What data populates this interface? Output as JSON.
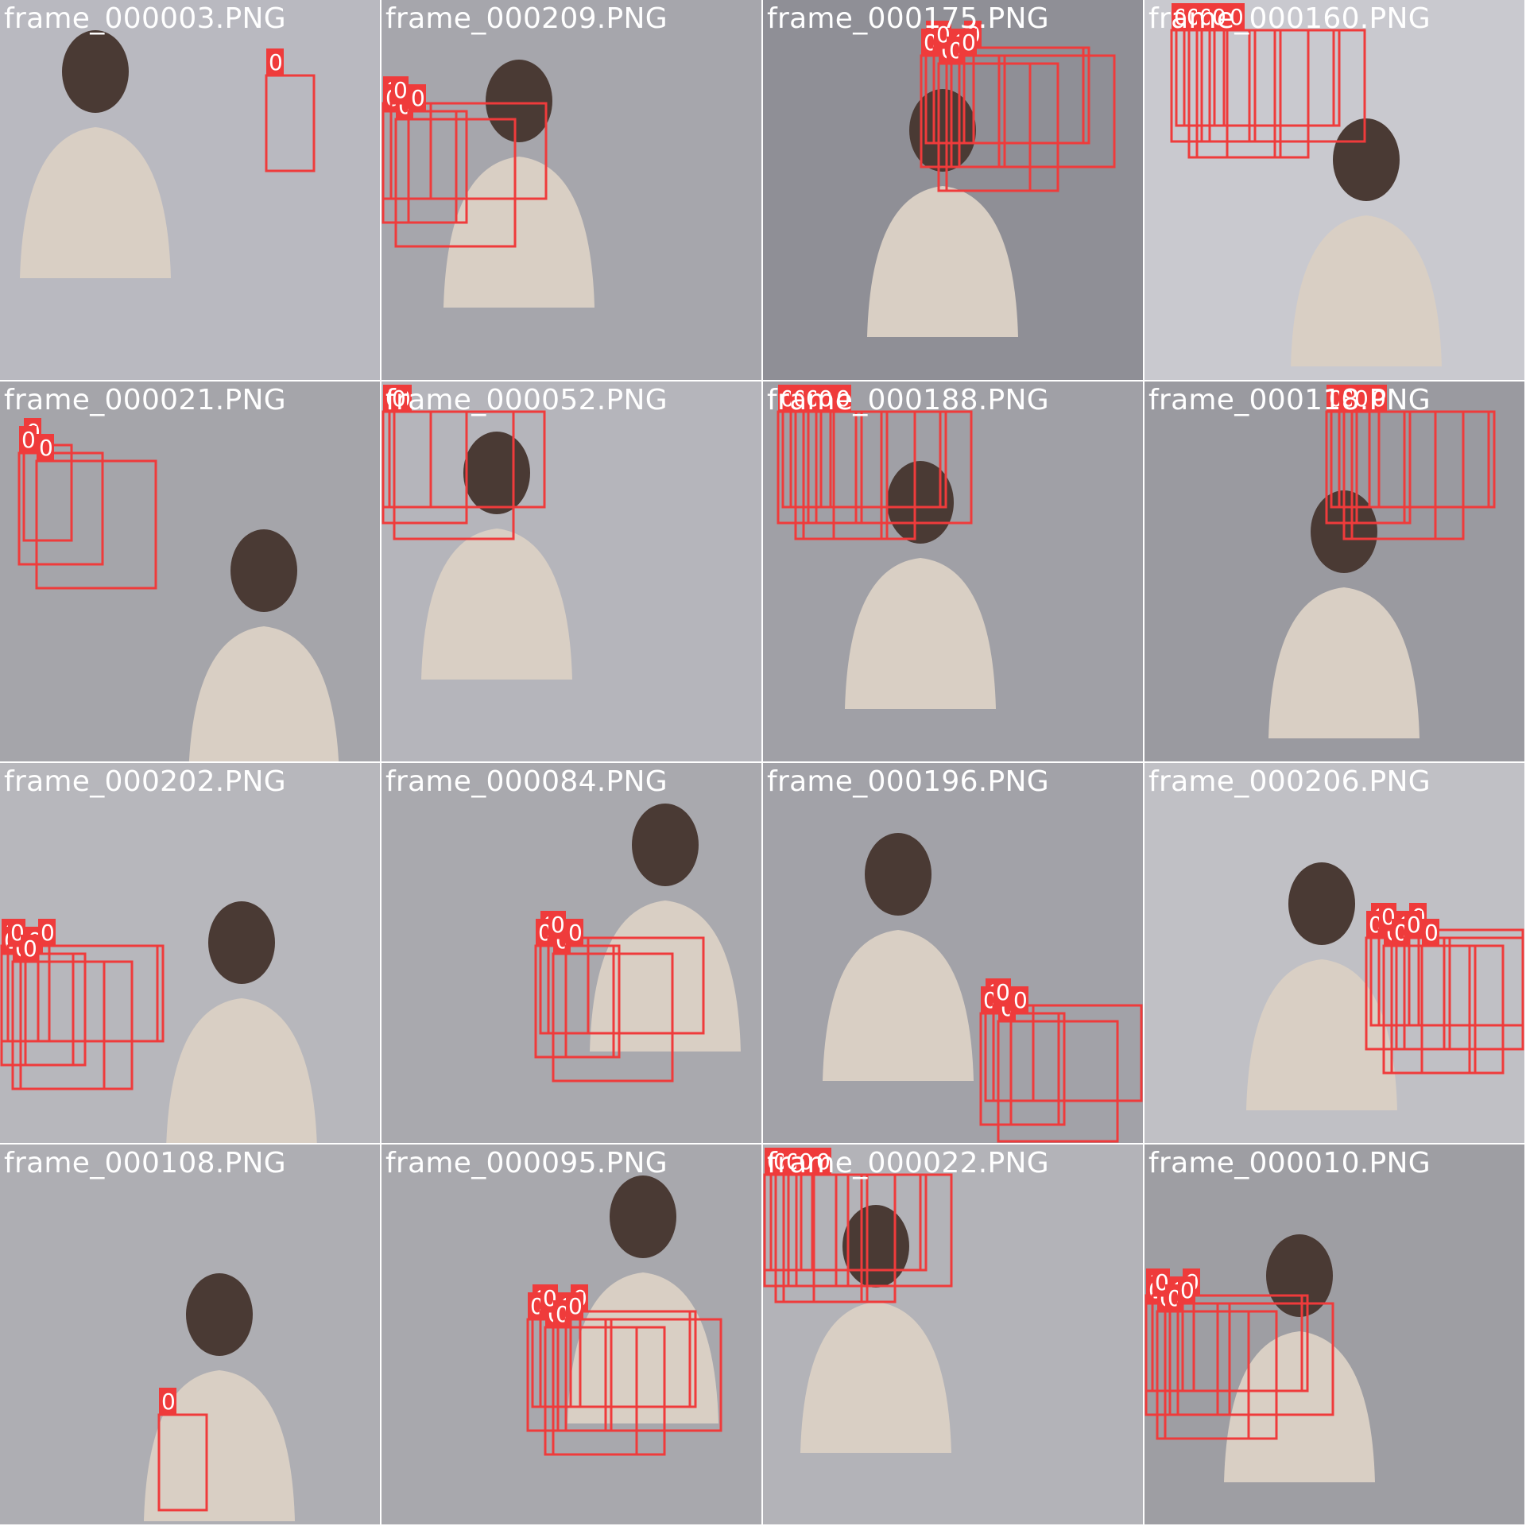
{
  "label_color": "#ef3b3b",
  "detection_class": "0",
  "tiles": [
    {
      "file": "frame_000003.PNG",
      "boxes": 1
    },
    {
      "file": "frame_000209.PNG",
      "boxes": 5
    },
    {
      "file": "frame_000175.PNG",
      "boxes": 8
    },
    {
      "file": "frame_000160.PNG",
      "boxes": 9
    },
    {
      "file": "frame_000021.PNG",
      "boxes": 3
    },
    {
      "file": "frame_000052.PNG",
      "boxes": 4
    },
    {
      "file": "frame_000188.PNG",
      "boxes": 9
    },
    {
      "file": "frame_000118.PNG",
      "boxes": 7
    },
    {
      "file": "frame_000202.PNG",
      "boxes": 7
    },
    {
      "file": "frame_000084.PNG",
      "boxes": 5
    },
    {
      "file": "frame_000196.PNG",
      "boxes": 5
    },
    {
      "file": "frame_000206.PNG",
      "boxes": 9
    },
    {
      "file": "frame_000108.PNG",
      "boxes": 1
    },
    {
      "file": "frame_000095.PNG",
      "boxes": 8
    },
    {
      "file": "frame_000022.PNG",
      "boxes": 9
    },
    {
      "file": "frame_000010.PNG",
      "boxes": 8
    }
  ]
}
